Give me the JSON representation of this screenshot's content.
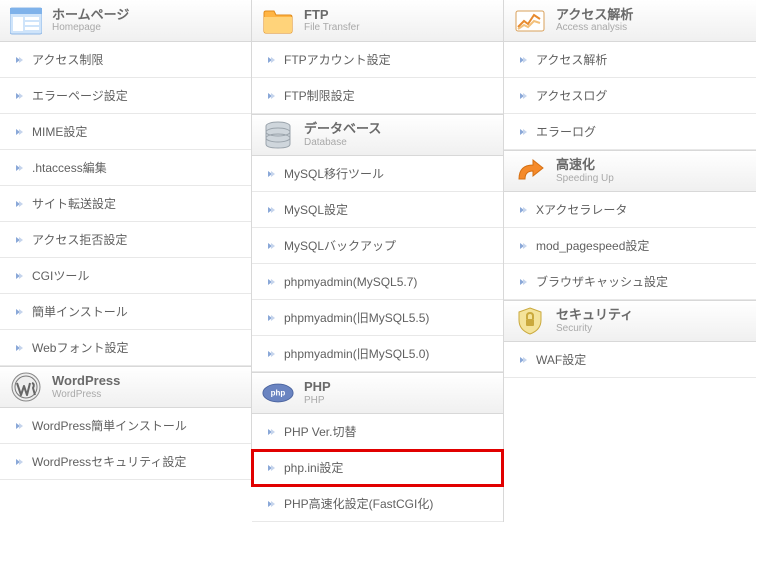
{
  "col1": {
    "homepage": {
      "title": "ホームページ",
      "subtitle": "Homepage",
      "items": [
        "アクセス制限",
        "エラーページ設定",
        "MIME設定",
        ".htaccess編集",
        "サイト転送設定",
        "アクセス拒否設定",
        "CGIツール",
        "簡単インストール",
        "Webフォント設定"
      ]
    },
    "wordpress": {
      "title": "WordPress",
      "subtitle": "WordPress",
      "items": [
        "WordPress簡単インストール",
        "WordPressセキュリティ設定"
      ]
    }
  },
  "col2": {
    "ftp": {
      "title": "FTP",
      "subtitle": "File Transfer",
      "items": [
        "FTPアカウント設定",
        "FTP制限設定"
      ]
    },
    "database": {
      "title": "データベース",
      "subtitle": "Database",
      "items": [
        "MySQL移行ツール",
        "MySQL設定",
        "MySQLバックアップ",
        "phpmyadmin(MySQL5.7)",
        "phpmyadmin(旧MySQL5.5)",
        "phpmyadmin(旧MySQL5.0)"
      ]
    },
    "php": {
      "title": "PHP",
      "subtitle": "PHP",
      "items": [
        "PHP Ver.切替",
        "php.ini設定",
        "PHP高速化設定(FastCGI化)"
      ],
      "highlightIndex": 1
    }
  },
  "col3": {
    "access": {
      "title": "アクセス解析",
      "subtitle": "Access analysis",
      "items": [
        "アクセス解析",
        "アクセスログ",
        "エラーログ"
      ]
    },
    "speedup": {
      "title": "高速化",
      "subtitle": "Speeding Up",
      "items": [
        "Xアクセラレータ",
        "mod_pagespeed設定",
        "ブラウザキャッシュ設定"
      ]
    },
    "security": {
      "title": "セキュリティ",
      "subtitle": "Security",
      "items": [
        "WAF設定"
      ]
    }
  }
}
